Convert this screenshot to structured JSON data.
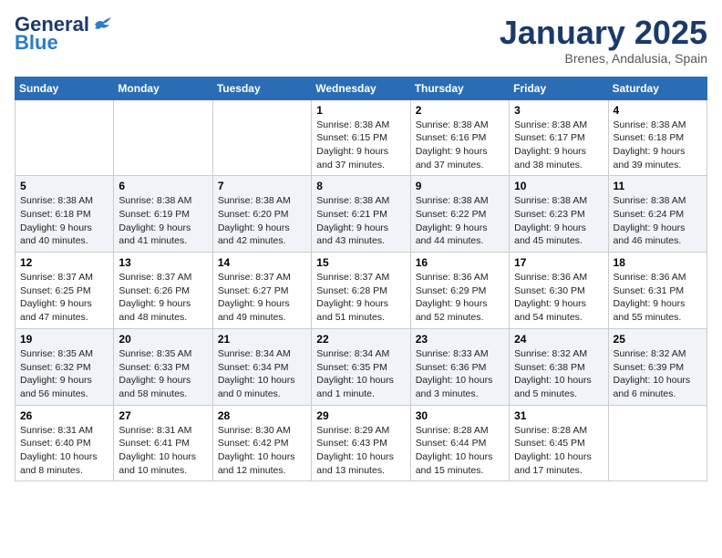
{
  "header": {
    "logo_general": "General",
    "logo_blue": "Blue",
    "title": "January 2025",
    "subtitle": "Brenes, Andalusia, Spain"
  },
  "days_of_week": [
    "Sunday",
    "Monday",
    "Tuesday",
    "Wednesday",
    "Thursday",
    "Friday",
    "Saturday"
  ],
  "weeks": [
    {
      "days": [
        {
          "num": "",
          "info": ""
        },
        {
          "num": "",
          "info": ""
        },
        {
          "num": "",
          "info": ""
        },
        {
          "num": "1",
          "info": "Sunrise: 8:38 AM\nSunset: 6:15 PM\nDaylight: 9 hours\nand 37 minutes."
        },
        {
          "num": "2",
          "info": "Sunrise: 8:38 AM\nSunset: 6:16 PM\nDaylight: 9 hours\nand 37 minutes."
        },
        {
          "num": "3",
          "info": "Sunrise: 8:38 AM\nSunset: 6:17 PM\nDaylight: 9 hours\nand 38 minutes."
        },
        {
          "num": "4",
          "info": "Sunrise: 8:38 AM\nSunset: 6:18 PM\nDaylight: 9 hours\nand 39 minutes."
        }
      ]
    },
    {
      "days": [
        {
          "num": "5",
          "info": "Sunrise: 8:38 AM\nSunset: 6:18 PM\nDaylight: 9 hours\nand 40 minutes."
        },
        {
          "num": "6",
          "info": "Sunrise: 8:38 AM\nSunset: 6:19 PM\nDaylight: 9 hours\nand 41 minutes."
        },
        {
          "num": "7",
          "info": "Sunrise: 8:38 AM\nSunset: 6:20 PM\nDaylight: 9 hours\nand 42 minutes."
        },
        {
          "num": "8",
          "info": "Sunrise: 8:38 AM\nSunset: 6:21 PM\nDaylight: 9 hours\nand 43 minutes."
        },
        {
          "num": "9",
          "info": "Sunrise: 8:38 AM\nSunset: 6:22 PM\nDaylight: 9 hours\nand 44 minutes."
        },
        {
          "num": "10",
          "info": "Sunrise: 8:38 AM\nSunset: 6:23 PM\nDaylight: 9 hours\nand 45 minutes."
        },
        {
          "num": "11",
          "info": "Sunrise: 8:38 AM\nSunset: 6:24 PM\nDaylight: 9 hours\nand 46 minutes."
        }
      ]
    },
    {
      "days": [
        {
          "num": "12",
          "info": "Sunrise: 8:37 AM\nSunset: 6:25 PM\nDaylight: 9 hours\nand 47 minutes."
        },
        {
          "num": "13",
          "info": "Sunrise: 8:37 AM\nSunset: 6:26 PM\nDaylight: 9 hours\nand 48 minutes."
        },
        {
          "num": "14",
          "info": "Sunrise: 8:37 AM\nSunset: 6:27 PM\nDaylight: 9 hours\nand 49 minutes."
        },
        {
          "num": "15",
          "info": "Sunrise: 8:37 AM\nSunset: 6:28 PM\nDaylight: 9 hours\nand 51 minutes."
        },
        {
          "num": "16",
          "info": "Sunrise: 8:36 AM\nSunset: 6:29 PM\nDaylight: 9 hours\nand 52 minutes."
        },
        {
          "num": "17",
          "info": "Sunrise: 8:36 AM\nSunset: 6:30 PM\nDaylight: 9 hours\nand 54 minutes."
        },
        {
          "num": "18",
          "info": "Sunrise: 8:36 AM\nSunset: 6:31 PM\nDaylight: 9 hours\nand 55 minutes."
        }
      ]
    },
    {
      "days": [
        {
          "num": "19",
          "info": "Sunrise: 8:35 AM\nSunset: 6:32 PM\nDaylight: 9 hours\nand 56 minutes."
        },
        {
          "num": "20",
          "info": "Sunrise: 8:35 AM\nSunset: 6:33 PM\nDaylight: 9 hours\nand 58 minutes."
        },
        {
          "num": "21",
          "info": "Sunrise: 8:34 AM\nSunset: 6:34 PM\nDaylight: 10 hours\nand 0 minutes."
        },
        {
          "num": "22",
          "info": "Sunrise: 8:34 AM\nSunset: 6:35 PM\nDaylight: 10 hours\nand 1 minute."
        },
        {
          "num": "23",
          "info": "Sunrise: 8:33 AM\nSunset: 6:36 PM\nDaylight: 10 hours\nand 3 minutes."
        },
        {
          "num": "24",
          "info": "Sunrise: 8:32 AM\nSunset: 6:38 PM\nDaylight: 10 hours\nand 5 minutes."
        },
        {
          "num": "25",
          "info": "Sunrise: 8:32 AM\nSunset: 6:39 PM\nDaylight: 10 hours\nand 6 minutes."
        }
      ]
    },
    {
      "days": [
        {
          "num": "26",
          "info": "Sunrise: 8:31 AM\nSunset: 6:40 PM\nDaylight: 10 hours\nand 8 minutes."
        },
        {
          "num": "27",
          "info": "Sunrise: 8:31 AM\nSunset: 6:41 PM\nDaylight: 10 hours\nand 10 minutes."
        },
        {
          "num": "28",
          "info": "Sunrise: 8:30 AM\nSunset: 6:42 PM\nDaylight: 10 hours\nand 12 minutes."
        },
        {
          "num": "29",
          "info": "Sunrise: 8:29 AM\nSunset: 6:43 PM\nDaylight: 10 hours\nand 13 minutes."
        },
        {
          "num": "30",
          "info": "Sunrise: 8:28 AM\nSunset: 6:44 PM\nDaylight: 10 hours\nand 15 minutes."
        },
        {
          "num": "31",
          "info": "Sunrise: 8:28 AM\nSunset: 6:45 PM\nDaylight: 10 hours\nand 17 minutes."
        },
        {
          "num": "",
          "info": ""
        }
      ]
    }
  ]
}
